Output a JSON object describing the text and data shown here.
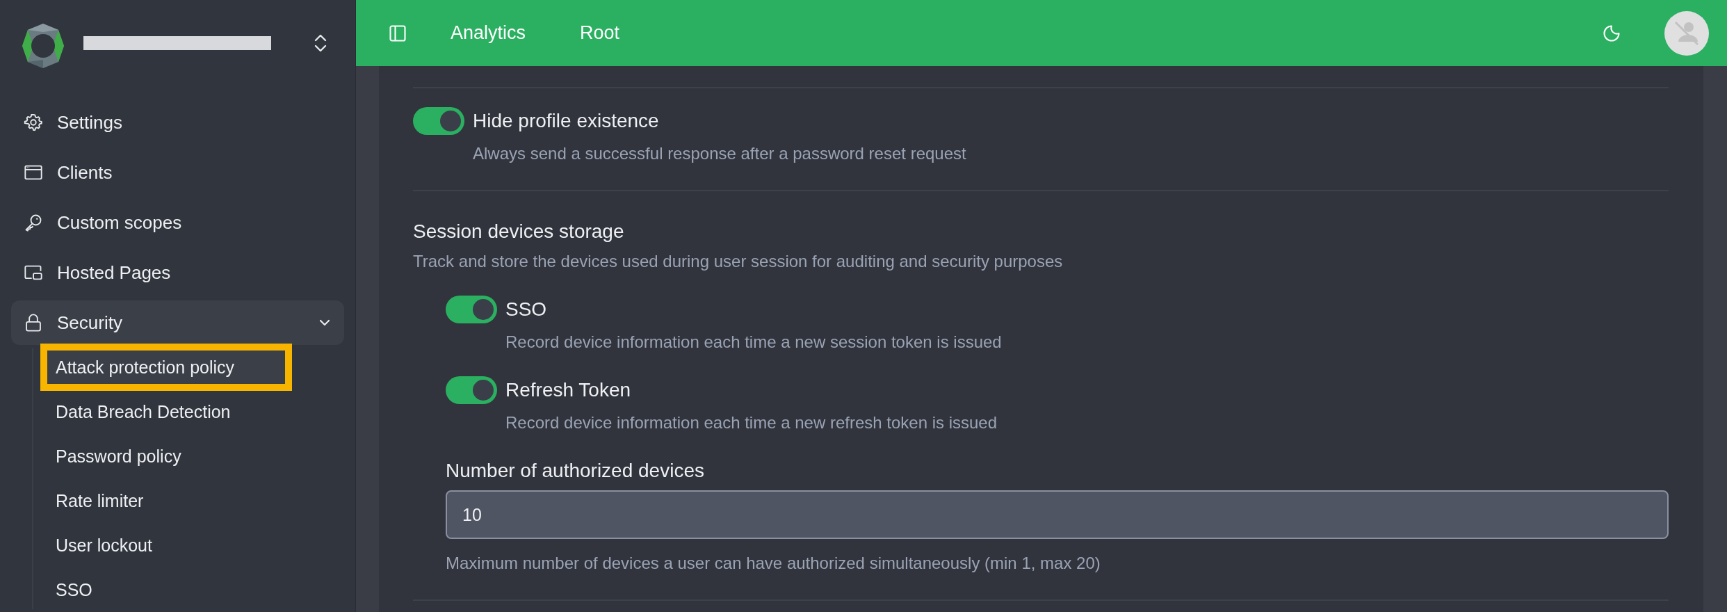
{
  "sidebar": {
    "items": [
      {
        "label": "Settings"
      },
      {
        "label": "Clients"
      },
      {
        "label": "Custom scopes"
      },
      {
        "label": "Hosted Pages"
      },
      {
        "label": "Security",
        "expanded": true,
        "children": [
          {
            "label": "Attack protection policy",
            "selected": true,
            "highlighted": true
          },
          {
            "label": "Data Breach Detection",
            "selected": false,
            "highlighted": false
          },
          {
            "label": "Password policy",
            "selected": false,
            "highlighted": false
          },
          {
            "label": "Rate limiter",
            "selected": false,
            "highlighted": false
          },
          {
            "label": "User lockout",
            "selected": false,
            "highlighted": false
          },
          {
            "label": "SSO",
            "selected": false,
            "highlighted": false
          }
        ]
      }
    ]
  },
  "header": {
    "breadcrumbs": [
      "Analytics",
      "Root"
    ]
  },
  "content": {
    "hide_profile": {
      "label": "Hide profile existence",
      "description": "Always send a successful response after a password reset request",
      "on": true
    },
    "session_devices": {
      "title": "Session devices storage",
      "description": "Track and store the devices used during user session for auditing and security purposes",
      "toggles": [
        {
          "label": "SSO",
          "description": "Record device information each time a new session token is issued",
          "on": true
        },
        {
          "label": "Refresh Token",
          "description": "Record device information each time a new refresh token is issued",
          "on": true
        }
      ],
      "max_devices": {
        "label": "Number of authorized devices",
        "value": "10",
        "help": "Maximum number of devices a user can have authorized simultaneously (min 1, max 20)"
      }
    }
  }
}
